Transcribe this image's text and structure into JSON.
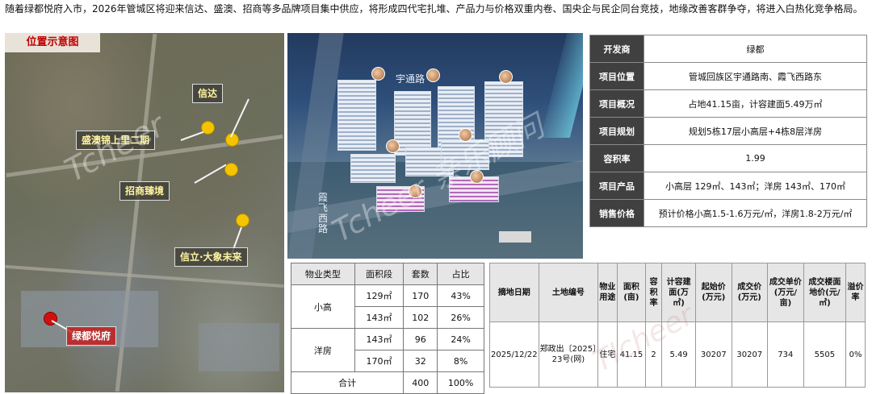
{
  "intro": "随着绿都悦府入市，2026年管城区将迎来信达、盛澳、招商等多品牌项目集中供应，将形成四代宅扎堆、产品力与价格双重内卷、国央企与民企同台竞技，地缘改善客群争夺，将进入白热化竞争格局。",
  "map": {
    "title": "位置示意图",
    "labels": {
      "xinda": "信达",
      "shengao": "盛澳锦上里二期",
      "zhaoshang": "招商臻境",
      "xinli": "信立·大象未来",
      "lvdu": "绿都悦府"
    },
    "watermark": "Tcheer"
  },
  "render": {
    "road_top": "宇通路",
    "road_left": "霞飞西路",
    "watermark": "Tcheer 亲乐顾问"
  },
  "info": {
    "rows": [
      {
        "k": "开发商",
        "v": "绿都"
      },
      {
        "k": "项目位置",
        "v": "管城回族区宇通路南、霞飞西路东"
      },
      {
        "k": "项目概况",
        "v": "占地41.15亩，计容建面5.49万㎡"
      },
      {
        "k": "项目规划",
        "v": "规划5栋17层小高层+4栋8层洋房"
      },
      {
        "k": "容积率",
        "v": "1.99"
      },
      {
        "k": "项目产品",
        "v": "小高层 129㎡、143㎡；洋房 143㎡、170㎡"
      },
      {
        "k": "销售价格",
        "v": "预计价格小高1.5-1.6万元/㎡，洋房1.8-2万元/㎡"
      }
    ]
  },
  "mix": {
    "headers": [
      "物业类型",
      "面积段",
      "套数",
      "占比"
    ],
    "groups": [
      {
        "type": "小高",
        "rows": [
          [
            "129㎡",
            "170",
            "43%"
          ],
          [
            "143㎡",
            "102",
            "26%"
          ]
        ]
      },
      {
        "type": "洋房",
        "rows": [
          [
            "143㎡",
            "96",
            "24%"
          ],
          [
            "170㎡",
            "32",
            "8%"
          ]
        ]
      }
    ],
    "total": {
      "label": "合计",
      "units": "400",
      "share": "100%"
    }
  },
  "land": {
    "headers": [
      "摘地日期",
      "土地编号",
      "物业用途",
      "面积(亩)",
      "容积率",
      "计容建面(万㎡)",
      "起始价(万元)",
      "成交价(万元)",
      "成交单价(万元/亩)",
      "成交楼面地价(元/㎡)",
      "溢价率"
    ],
    "row": [
      "2025/12/22",
      "郑政出〔2025〕23号(网)",
      "住宅",
      "41.15",
      "2",
      "5.49",
      "30207",
      "30207",
      "734",
      "5505",
      "0%"
    ],
    "watermark": "TIcheer"
  }
}
